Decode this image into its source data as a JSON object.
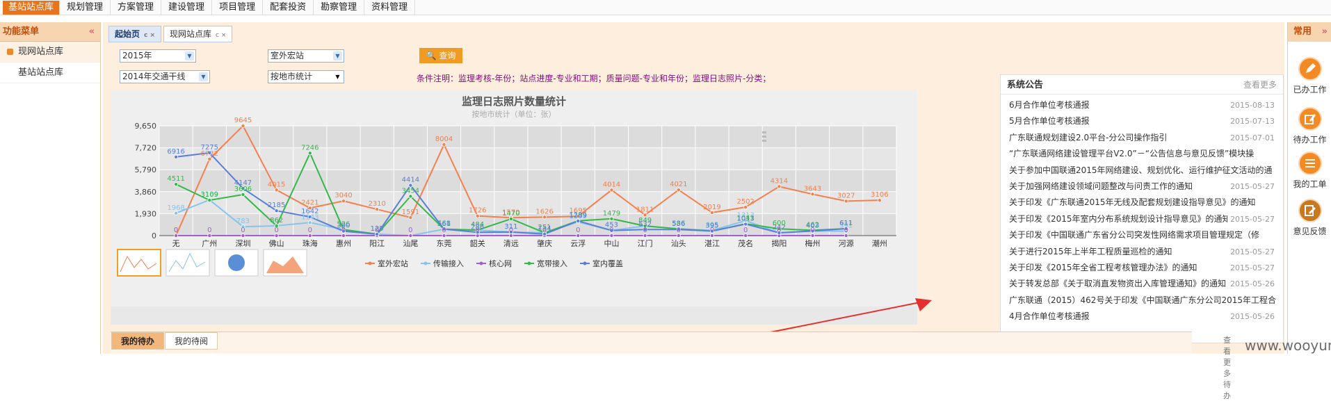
{
  "topnav": {
    "items": [
      "基站站点库",
      "规划管理",
      "方案管理",
      "建设管理",
      "项目管理",
      "配套投资",
      "勘察管理",
      "资料管理"
    ]
  },
  "leftpanel": {
    "title": "功能菜单",
    "collapse_icon": "«",
    "items": [
      "现网站点库",
      "基站站点库"
    ]
  },
  "tabs": [
    {
      "label": "起始页",
      "suffix": "c ×"
    },
    {
      "label": "现网站点库",
      "suffix": "c ×"
    }
  ],
  "filters": {
    "year": "2015年",
    "category": "室外宏站",
    "project": "2014年交通干线",
    "stat_mode": "按地市统计",
    "query_label": "查询",
    "condition_note": "条件注明：监理考核-年份；站点进度-专业和工期；质量问题-专业和年份；监理日志照片-分类；"
  },
  "chart_data": {
    "type": "line",
    "title": "监理日志照片数量统计",
    "subtitle": "按地市统计（单位：张）",
    "categories": [
      "无",
      "广州",
      "深圳",
      "佛山",
      "珠海",
      "惠州",
      "阳江",
      "汕尾",
      "东莞",
      "韶关",
      "清远",
      "肇庆",
      "云浮",
      "中山",
      "江门",
      "汕头",
      "湛江",
      "茂名",
      "揭阳",
      "梅州",
      "河源",
      "潮州"
    ],
    "yticks": [
      "9,650",
      "7,720",
      "5,790",
      "3,860",
      "1,930",
      "0"
    ],
    "ylim": [
      0,
      9650
    ],
    "grid": true,
    "legend_position": "bottom",
    "series": [
      {
        "name": "室外宏站",
        "color": "#f4804e",
        "values": [
          0,
          6732,
          9645,
          4015,
          2421,
          3040,
          2310,
          1591,
          8004,
          1726,
          1570,
          1626,
          1695,
          4014,
          1811,
          4021,
          2019,
          2502,
          4314,
          3643,
          3027,
          3106
        ]
      },
      {
        "name": "传输接入",
        "color": "#86c3f0",
        "values": [
          1968,
          3139,
          783,
          862,
          1143,
          526,
          127,
          0,
          561,
          484,
          311,
          251,
          1195,
          453,
          849,
          586,
          465,
          1313,
          242,
          403,
          391,
          null
        ]
      },
      {
        "name": "核心网",
        "color": "#9f5fcf",
        "values": [
          0,
          0,
          0,
          0,
          0,
          0,
          0,
          0,
          0,
          0,
          0,
          0,
          0,
          0,
          0,
          0,
          0,
          0,
          0,
          0,
          0,
          null
        ]
      },
      {
        "name": "宽带接入",
        "color": "#33b849",
        "values": [
          4511,
          3109,
          3606,
          862,
          7246,
          526,
          127,
          3454,
          561,
          484,
          1470,
          251,
          1299,
          1479,
          849,
          586,
          395,
          1041,
          600,
          462,
          611,
          null
        ]
      },
      {
        "name": "室内覆盖",
        "color": "#5a7fd9",
        "values": [
          6916,
          7275,
          4147,
          2185,
          1642,
          390,
          120,
          4414,
          568,
          286,
          311,
          134,
          1289,
          453,
          532,
          536,
          395,
          1013,
          242,
          403,
          611,
          null
        ]
      }
    ],
    "point_labels": [
      {
        "series": 0,
        "labels": [
          "0",
          "6732",
          "9645",
          "4015",
          "2421",
          "3040",
          "2310",
          "1591",
          "8004",
          "1726",
          "1570",
          "1626",
          "1695",
          "4014",
          "1811",
          "4021",
          "2019",
          "2502",
          "4314",
          "3643",
          "3027",
          "3106"
        ]
      },
      {
        "series": 1,
        "labels": [
          "1968",
          "3139",
          "783",
          "862",
          "1143",
          "526",
          "127",
          "",
          "561",
          "484",
          "311",
          "251",
          "1195",
          "453",
          "849",
          "586",
          "465",
          "1313",
          "242",
          "403",
          "391",
          ""
        ]
      },
      {
        "series": 2,
        "labels": [
          "0",
          "0",
          "0",
          "0",
          "0",
          "0",
          "0",
          "0",
          "0",
          "0",
          "0",
          "0",
          "0",
          "0",
          "0",
          "0",
          "0",
          "0",
          "0",
          "0",
          "0",
          ""
        ]
      },
      {
        "series": 3,
        "labels": [
          "4511",
          "3109",
          "3606",
          "862",
          "7246",
          "526",
          "127",
          "3454",
          "561",
          "484",
          "1470",
          "251",
          "1299",
          "1479",
          "849",
          "586",
          "395",
          "1041",
          "600",
          "462",
          "611",
          ""
        ]
      },
      {
        "series": 4,
        "labels": [
          "6916",
          "7275",
          "4147",
          "2185",
          "1642",
          "390",
          "120",
          "4414",
          "568",
          "286",
          "311",
          "134",
          "1289",
          "453",
          "532",
          "536",
          "395",
          "1013",
          "242",
          "403",
          "611",
          ""
        ]
      }
    ]
  },
  "notice": {
    "title": "系统公告",
    "more": "查看更多",
    "items": [
      {
        "text": "6月合作单位考核通报",
        "date": "2015-08-13"
      },
      {
        "text": "5月合作单位考核通报",
        "date": "2015-07-13"
      },
      {
        "text": "广东联通规划建设2.0平台-分公司操作指引",
        "date": "2015-07-01"
      },
      {
        "text": "“广东联通网络建设管理平台V2.0”－“公告信息与意见反馈”模块操",
        "date": ""
      },
      {
        "text": "关于参加中国联通2015年网络建设、规划优化、运行维护征文活动的通",
        "date": ""
      },
      {
        "text": "关于加强网络建设领域问题整改与问责工作的通知",
        "date": "2015-05-27"
      },
      {
        "text": "关于印发《广东联通2015年无线及配套规划建设指导意见》的通知",
        "date": ""
      },
      {
        "text": "关于印发《2015年室内分布系统规划设计指导意见》的通知",
        "date": "2015-05-27"
      },
      {
        "text": "关于印发《中国联通广东省分公司突发性网络需求项目管理规定（修",
        "date": ""
      },
      {
        "text": "关于进行2015年上半年工程质量巡检的通知",
        "date": "2015-05-27"
      },
      {
        "text": "关于印发《2015年全省工程考核管理办法》的通知",
        "date": "2015-05-27"
      },
      {
        "text": "关于转发总部《关于取消直发物资出入库管理通知》的通知",
        "date": "2015-05-26"
      },
      {
        "text": "广东联通（2015）462号关于印发《中国联通广东分公司2015年工程合",
        "date": ""
      },
      {
        "text": "4月合作单位考核通报",
        "date": "2015-05-26"
      }
    ]
  },
  "bottomtabs": [
    "我的待办",
    "我的待阅"
  ],
  "bottom_more": "查看更多待办",
  "rightpanel": {
    "title": "常用",
    "expand_icon": "»",
    "items": [
      {
        "label": "已办工作",
        "icon": "pencil-icon"
      },
      {
        "label": "待办工作",
        "icon": "edit-icon"
      },
      {
        "label": "我的工单",
        "icon": "list-icon"
      },
      {
        "label": "意见反馈",
        "icon": "feedback-icon"
      }
    ]
  },
  "watermark": "www.wooyun.org"
}
